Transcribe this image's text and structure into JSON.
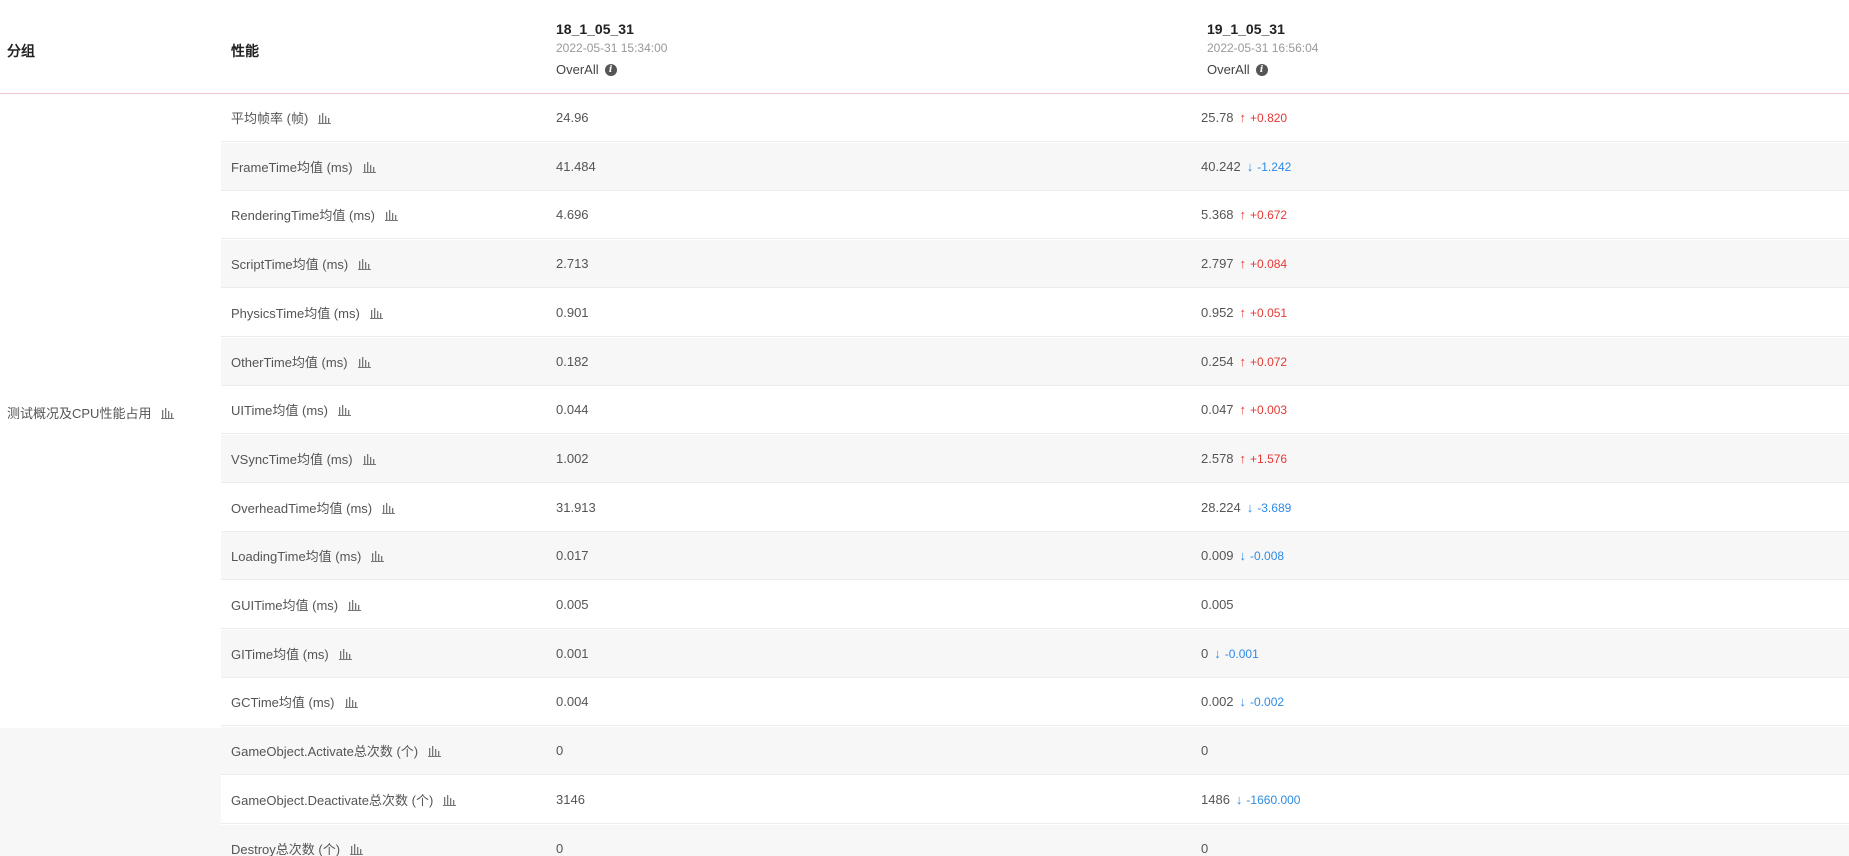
{
  "header": {
    "group_label": "分组",
    "metric_label": "性能",
    "runs": [
      {
        "name": "18_1_05_31",
        "time": "2022-05-31 15:34:00",
        "overall": "OverAll"
      },
      {
        "name": "19_1_05_31",
        "time": "2022-05-31 16:56:04",
        "overall": "OverAll"
      }
    ]
  },
  "groups": [
    {
      "label": "测试概况及CPU性能占用",
      "icon": "bar-chart-icon"
    },
    {
      "label": "",
      "icon": ""
    }
  ],
  "rows": [
    {
      "metric": "平均帧率 (帧)",
      "a": "24.96",
      "b": "25.78",
      "delta": "+0.820",
      "dir": "up"
    },
    {
      "metric": "FrameTime均值 (ms)",
      "a": "41.484",
      "b": "40.242",
      "delta": "-1.242",
      "dir": "down"
    },
    {
      "metric": "RenderingTime均值 (ms)",
      "a": "4.696",
      "b": "5.368",
      "delta": "+0.672",
      "dir": "up"
    },
    {
      "metric": "ScriptTime均值 (ms)",
      "a": "2.713",
      "b": "2.797",
      "delta": "+0.084",
      "dir": "up"
    },
    {
      "metric": "PhysicsTime均值 (ms)",
      "a": "0.901",
      "b": "0.952",
      "delta": "+0.051",
      "dir": "up"
    },
    {
      "metric": "OtherTime均值 (ms)",
      "a": "0.182",
      "b": "0.254",
      "delta": "+0.072",
      "dir": "up"
    },
    {
      "metric": "UITime均值 (ms)",
      "a": "0.044",
      "b": "0.047",
      "delta": "+0.003",
      "dir": "up"
    },
    {
      "metric": "VSyncTime均值 (ms)",
      "a": "1.002",
      "b": "2.578",
      "delta": "+1.576",
      "dir": "up"
    },
    {
      "metric": "OverheadTime均值 (ms)",
      "a": "31.913",
      "b": "28.224",
      "delta": "-3.689",
      "dir": "down"
    },
    {
      "metric": "LoadingTime均值 (ms)",
      "a": "0.017",
      "b": "0.009",
      "delta": "-0.008",
      "dir": "down"
    },
    {
      "metric": "GUITime均值 (ms)",
      "a": "0.005",
      "b": "0.005",
      "delta": "",
      "dir": ""
    },
    {
      "metric": "GITime均值 (ms)",
      "a": "0.001",
      "b": "0",
      "delta": "-0.001",
      "dir": "down"
    },
    {
      "metric": "GCTime均值 (ms)",
      "a": "0.004",
      "b": "0.002",
      "delta": "-0.002",
      "dir": "down"
    },
    {
      "metric": "GameObject.Activate总次数 (个)",
      "a": "0",
      "b": "0",
      "delta": "",
      "dir": ""
    },
    {
      "metric": "GameObject.Deactivate总次数 (个)",
      "a": "3146",
      "b": "1486",
      "delta": "-1660.000",
      "dir": "down"
    },
    {
      "metric": "Destroy总次数 (个)",
      "a": "0",
      "b": "0",
      "delta": "",
      "dir": ""
    }
  ],
  "colors": {
    "up": "#e53935",
    "down": "#2f8be6",
    "header_divider": "#efc4cb"
  }
}
